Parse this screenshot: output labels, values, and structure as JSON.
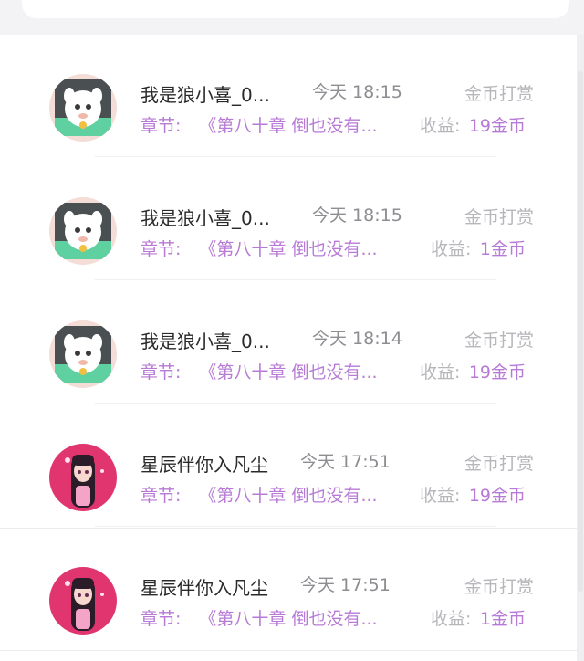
{
  "search": {
    "icon": "search-icon"
  },
  "records": [
    {
      "name": "我是狼小喜_0...",
      "time": "今天 18:15",
      "type": "金币打赏",
      "chapter_label": "章节:",
      "chapter_title": "《第八十章 倒也没有...",
      "income_label": "收益:",
      "income_value": "19金币",
      "avatar": "cartoon-goat-avatar"
    },
    {
      "name": "我是狼小喜_0...",
      "time": "今天 18:15",
      "type": "金币打赏",
      "chapter_label": "章节:",
      "chapter_title": "《第八十章 倒也没有...",
      "income_label": "收益:",
      "income_value": "1金币",
      "avatar": "cartoon-goat-avatar"
    },
    {
      "name": "我是狼小喜_0...",
      "time": "今天 18:14",
      "type": "金币打赏",
      "chapter_label": "章节:",
      "chapter_title": "《第八十章 倒也没有...",
      "income_label": "收益:",
      "income_value": "19金币",
      "avatar": "cartoon-goat-avatar"
    },
    {
      "name": "星辰伴你入凡尘",
      "time": "今天 17:51",
      "type": "金币打赏",
      "chapter_label": "章节:",
      "chapter_title": "《第八十章 倒也没有...",
      "income_label": "收益:",
      "income_value": "19金币",
      "avatar": "anime-girl-avatar"
    },
    {
      "name": "星辰伴你入凡尘",
      "time": "今天 17:51",
      "type": "金币打赏",
      "chapter_label": "章节:",
      "chapter_title": "《第八十章 倒也没有...",
      "income_label": "收益:",
      "income_value": "1金币",
      "avatar": "anime-girl-avatar"
    }
  ],
  "colors": {
    "accent": "#b77ad6",
    "name_text": "#2a2a2a",
    "muted_text": "#b6b6bb",
    "time_text": "#8d8d92",
    "background": "#f5f5f6"
  }
}
